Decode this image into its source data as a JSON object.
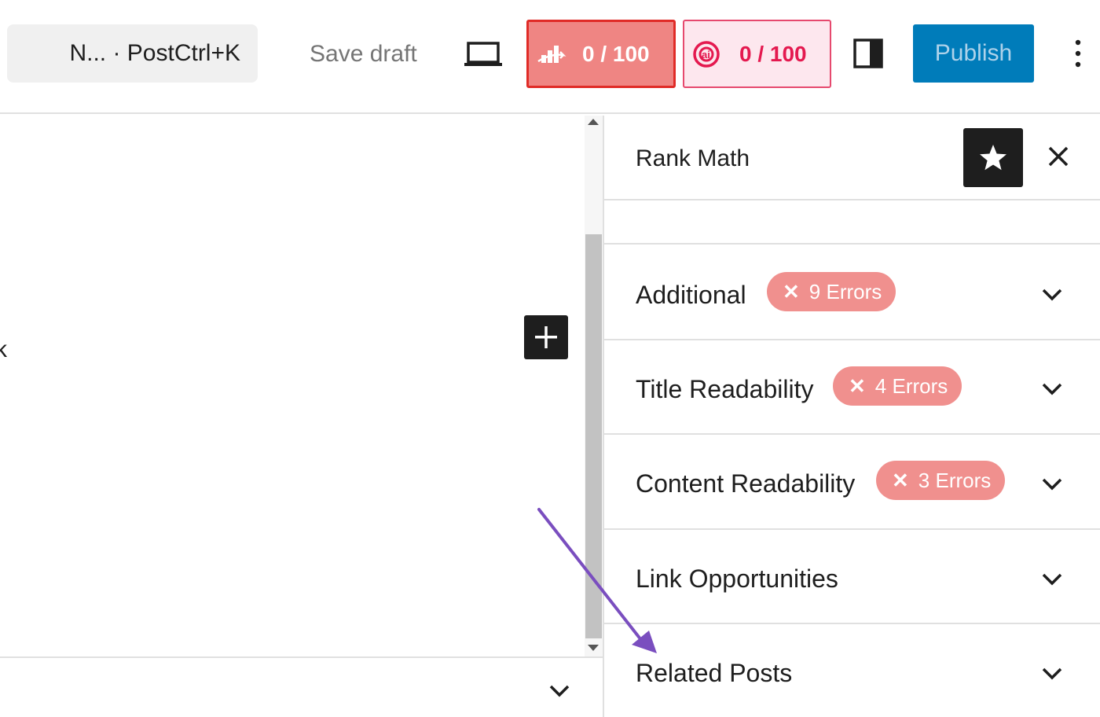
{
  "topbar": {
    "command": "N... · PostCtrl+K",
    "save_draft": "Save draft",
    "seo_score": "0 / 100",
    "ai_score": "0 / 100",
    "publish": "Publish"
  },
  "editor": {
    "edge_glyph": "k"
  },
  "sidebar": {
    "title": "Rank Math",
    "sections": [
      {
        "title": "Additional",
        "badge": "9 Errors"
      },
      {
        "title": "Title Readability",
        "badge": "4 Errors"
      },
      {
        "title": "Content Readability",
        "badge": "3 Errors"
      },
      {
        "title": "Link Opportunities"
      },
      {
        "title": "Related Posts"
      }
    ],
    "badge_x": "✕"
  },
  "colors": {
    "publish_bg": "#007cba",
    "seo_score_bg": "#ef8583",
    "seo_score_border": "#e02b27",
    "ai_score_bg": "#fde7ee",
    "ai_score_text": "#e4194f",
    "error_badge": "#f0908e",
    "annotation_arrow": "#7a4ebf"
  },
  "icons": {
    "device_preview": "laptop-icon",
    "seo_score": "rank-math-chart-icon",
    "ai_score": "content-ai-icon",
    "settings_panel": "sidebar-toggle-icon",
    "options": "more-vertical-icon",
    "star": "star-icon",
    "close": "close-icon",
    "add_block": "plus-icon",
    "expand": "chevron-down-icon"
  }
}
